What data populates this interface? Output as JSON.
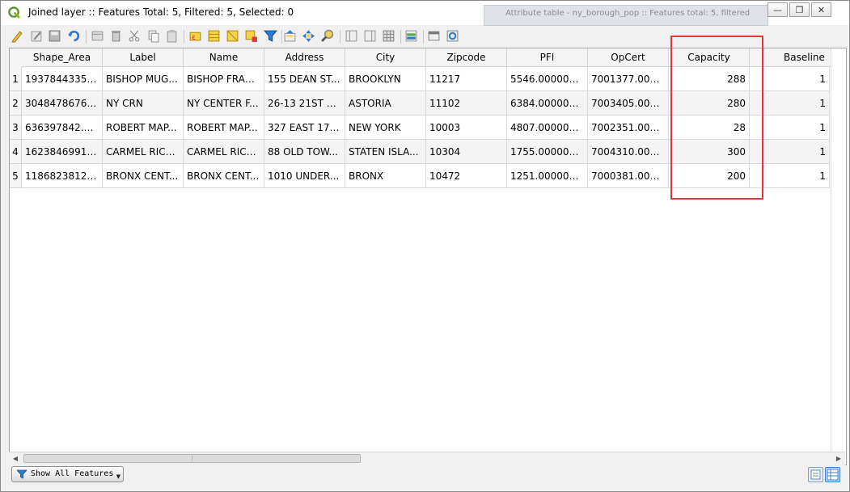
{
  "window": {
    "title": "Joined layer :: Features Total: 5, Filtered: 5, Selected: 0",
    "background_window_title": "Attribute table - ny_borough_pop :: Features total: 5, filtered",
    "controls": {
      "minimize": "—",
      "restore": "❐",
      "close": "✕"
    }
  },
  "toolbar": {
    "icons": [
      "toggle-editing-icon",
      "multi-edit-icon",
      "save-edits-icon",
      "reload-icon",
      "add-feature-icon",
      "delete-feature-icon",
      "cut-icon",
      "copy-icon",
      "paste-icon",
      "select-by-expression-icon",
      "select-all-icon",
      "invert-selection-icon",
      "deselect-icon",
      "filter-select-icon",
      "move-selection-to-top-icon",
      "pan-to-selection-icon",
      "zoom-to-selection-icon",
      "new-field-icon",
      "delete-field-icon",
      "field-calculator-icon",
      "conditional-formatting-icon",
      "dock-table-icon",
      "actions-icon"
    ]
  },
  "table": {
    "columns": [
      "Shape_Area",
      "Label",
      "Name",
      "Address",
      "City",
      "Zipcode",
      "PFI",
      "OpCert",
      "Capacity",
      "Baseline"
    ],
    "rows": [
      {
        "index": "1",
        "cells": [
          "1937844335.4...",
          "BISHOP MUG...",
          "BISHOP FRAN...",
          "155 DEAN ST...",
          "BROOKLYN",
          "11217",
          "5546.0000000...",
          "7001377.0000...",
          "288",
          "1"
        ]
      },
      {
        "index": "2",
        "cells": [
          "3048478676.5...",
          "NY CRN",
          "NY CENTER F...",
          "26-13 21ST S...",
          "ASTORIA",
          "11102",
          "6384.0000000...",
          "7003405.0000...",
          "280",
          "1"
        ]
      },
      {
        "index": "3",
        "cells": [
          "636397842.67...",
          "ROBERT MAP...",
          "ROBERT MAP...",
          "327 EAST 17T...",
          "NEW YORK",
          "10003",
          "4807.0000000...",
          "7002351.0000...",
          "28",
          "1"
        ]
      },
      {
        "index": "4",
        "cells": [
          "1623846991.5...",
          "CARMEL RICH...",
          "CARMEL RICH...",
          "88 OLD TOW...",
          "STATEN ISLA...",
          "10304",
          "1755.0000000...",
          "7004310.0000...",
          "300",
          "1"
        ]
      },
      {
        "index": "5",
        "cells": [
          "1186823812.5...",
          "BRONX CENT...",
          "BRONX CENT...",
          "1010 UNDER...",
          "BRONX",
          "10472",
          "1251.0000000...",
          "7000381.0000...",
          "200",
          "1"
        ]
      }
    ],
    "highlight_color": "#e8343a"
  },
  "bottom": {
    "show_features_label": "Show All Features",
    "view_modes": [
      "form-view-icon",
      "table-view-icon"
    ]
  },
  "colors": {
    "accent": "#3c7fc2",
    "highlight": "#e8343a"
  }
}
